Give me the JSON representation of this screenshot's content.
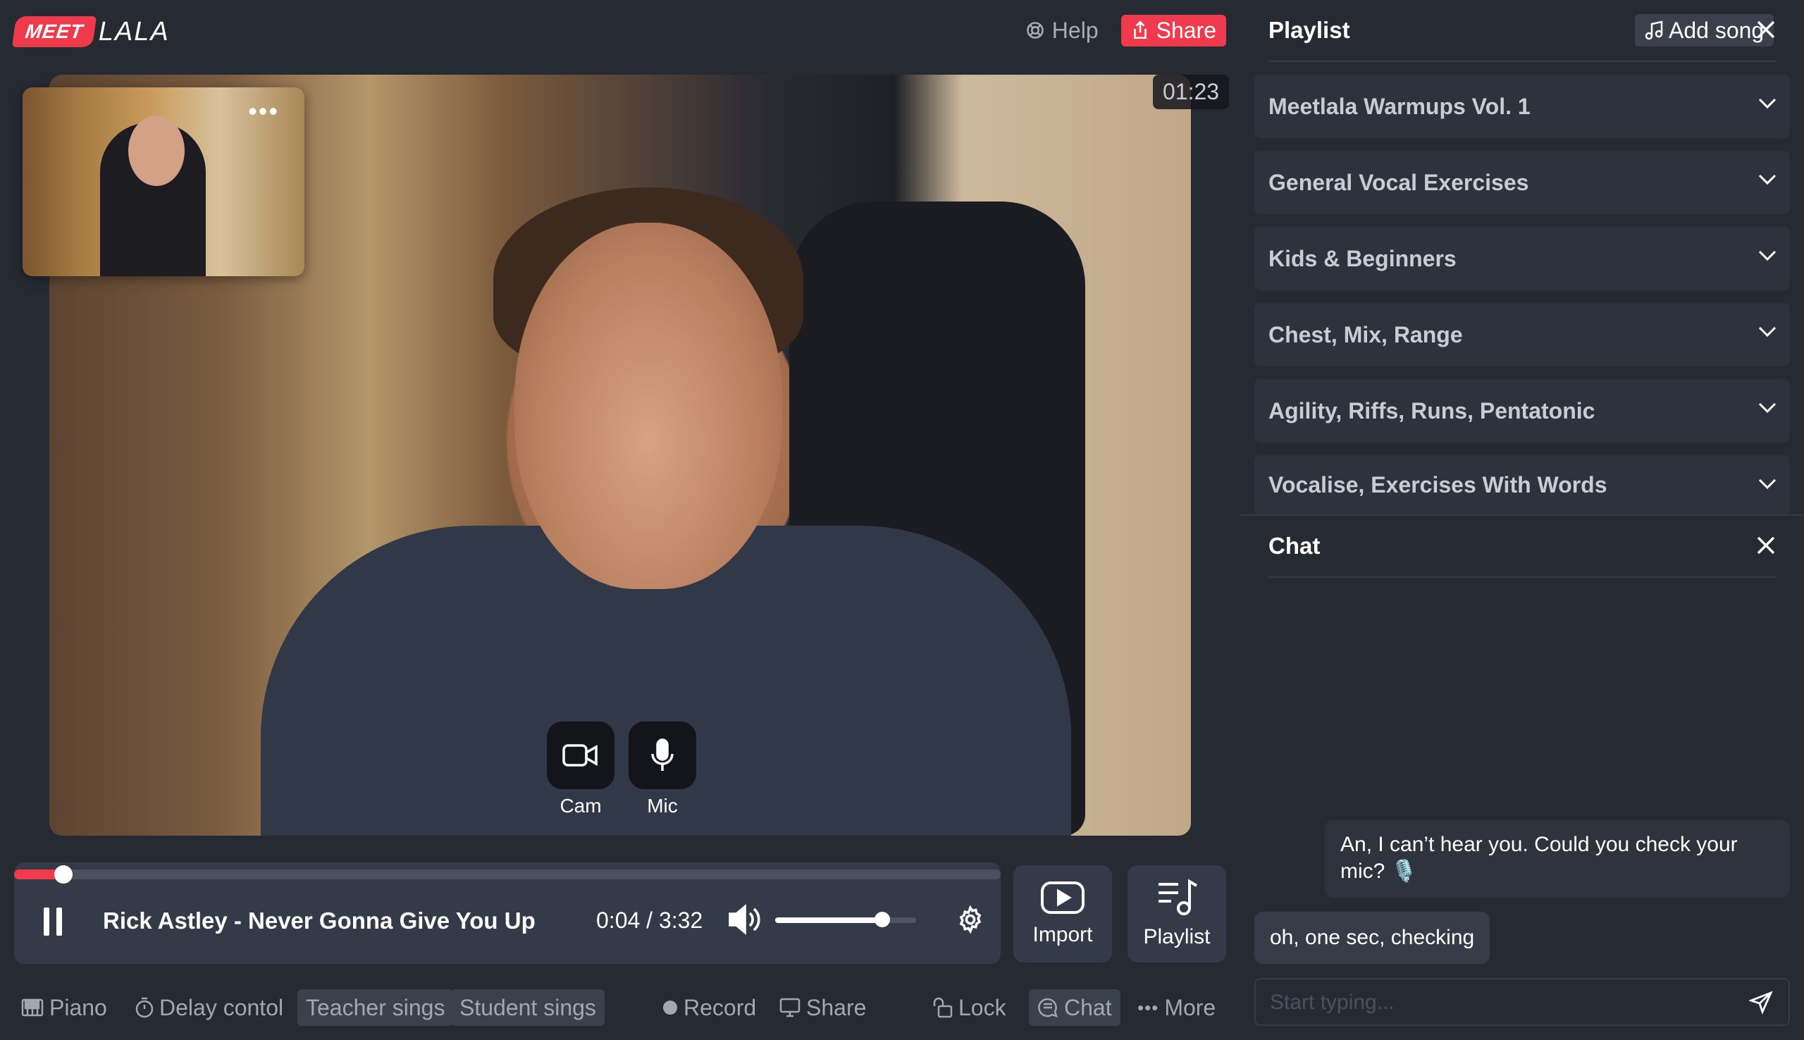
{
  "brand": {
    "meet": "MEET",
    "lala": "LALA"
  },
  "header": {
    "help_label": "Help",
    "share_label": "Share"
  },
  "video": {
    "timer": "01:23"
  },
  "media_controls": {
    "cam_label": "Cam",
    "mic_label": "Mic"
  },
  "player": {
    "song_title": "Rick Astley - Never Gonna Give You Up",
    "time": "0:04 / 3:32",
    "progress_fraction": 0.05,
    "volume_fraction": 0.76
  },
  "side_actions": {
    "import_label": "Import",
    "playlist_label": "Playlist"
  },
  "toolbar": {
    "piano": "Piano",
    "delay": "Delay contol",
    "teacher": "Teacher sings",
    "student": "Student sings",
    "record": "Record",
    "share": "Share",
    "lock": "Lock",
    "chat": "Chat",
    "more": "More"
  },
  "playlist": {
    "title": "Playlist",
    "add_song": "Add song",
    "items": [
      {
        "label": "Meetlala Warmups Vol. 1"
      },
      {
        "label": "General Vocal Exercises"
      },
      {
        "label": "Kids & Beginners"
      },
      {
        "label": "Chest, Mix, Range"
      },
      {
        "label": "Agility, Riffs, Runs, Pentatonic"
      },
      {
        "label": "Vocalise, Exercises With Words"
      }
    ]
  },
  "chat": {
    "title": "Chat",
    "messages": [
      {
        "from": "other",
        "text": "An, I can’t hear you. Could you check your mic? 🎙️"
      },
      {
        "from": "me",
        "text": "oh, one sec, checking"
      }
    ],
    "input_placeholder": "Start typing..."
  },
  "colors": {
    "accent": "#ef3b4d",
    "background": "#262a33",
    "panel": "#343a47"
  }
}
